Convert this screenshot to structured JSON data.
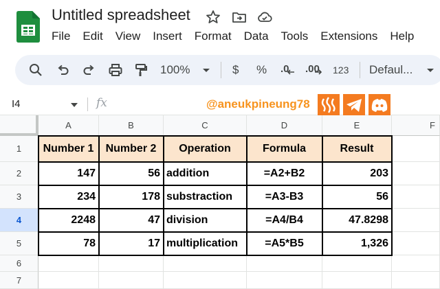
{
  "app": {
    "title": "Untitled spreadsheet",
    "brand_color": "#188038"
  },
  "menu": [
    "File",
    "Edit",
    "View",
    "Insert",
    "Format",
    "Data",
    "Tools",
    "Extensions",
    "Help"
  ],
  "toolbar": {
    "zoom": "100%",
    "currency": "$",
    "percent": "%",
    "decrease_decimal": ".0",
    "increase_decimal": ".00",
    "number_format": "123",
    "font": "Defaul..."
  },
  "formula_bar": {
    "cell_ref": "I4",
    "fx_label": "fx",
    "formula_value": ""
  },
  "watermark": {
    "handle": "@aneukpineung78",
    "icons": [
      "steem-icon",
      "telegram-icon",
      "discord-icon"
    ],
    "color": "#f47b20"
  },
  "sheet": {
    "columns": [
      "A",
      "B",
      "C",
      "D",
      "E",
      "F"
    ],
    "rows": [
      "1",
      "2",
      "3",
      "4",
      "5",
      "6",
      "7"
    ],
    "active_row": "4",
    "header_fill": "#fce5cd",
    "table": {
      "headers": [
        "Number 1",
        "Number 2",
        "Operation",
        "Formula",
        "Result"
      ],
      "records": [
        [
          "147",
          "56",
          "addition",
          "=A2+B2",
          "203"
        ],
        [
          "234",
          "178",
          "substraction",
          "=A3-B3",
          "56"
        ],
        [
          "2248",
          "47",
          "division",
          "=A4/B4",
          "47.8298"
        ],
        [
          "78",
          "17",
          "multiplication",
          "=A5*B5",
          "1,326"
        ]
      ]
    }
  }
}
